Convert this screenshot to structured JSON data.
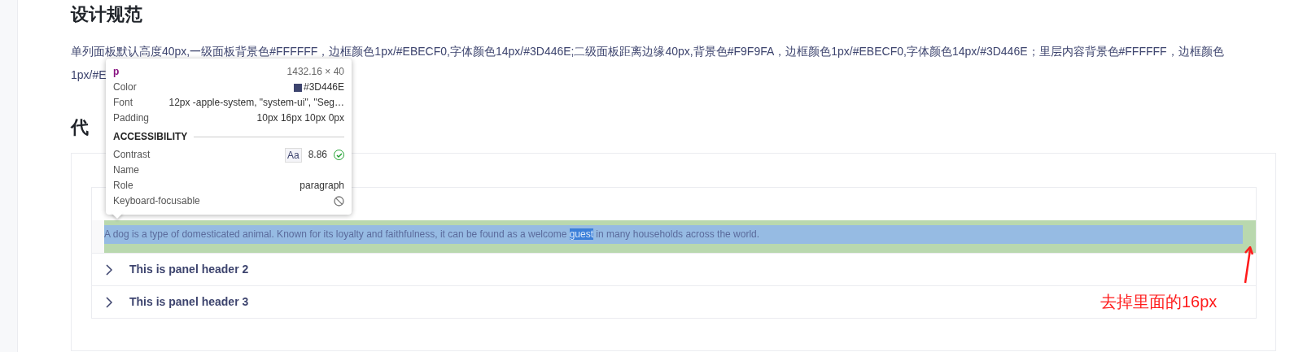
{
  "section_title": "设计规范",
  "description_lines": [
    "单列面板默认高度40px,一级面板背景色#FFFFFF，边框颜色1px/#EBECF0,字体颜色14px/#3D446E;二级面板距离边缘40px,背景色#F9F9FA，边框颜色1px/#EBECF0,字体颜色14px/#3D446E；里层内容背景色#FFFFFF，边框颜色",
    "1px/#E"
  ],
  "demo_title": "代",
  "panels": [
    {
      "expanded": true,
      "content": [
        {
          "text": "A dog is a type of domesticated animal. Known for its loyalty and faithfulness, it can be found as a welcome ",
          "highlighted": false
        },
        {
          "text": "guest",
          "highlighted": true
        },
        {
          "text": " in many households across the world.",
          "highlighted": false
        }
      ]
    },
    {
      "header": "This is panel header 2",
      "expanded": false
    },
    {
      "header": "This is panel header 3",
      "expanded": false
    }
  ],
  "inspector": {
    "tag": "p",
    "size": "1432.16 × 40",
    "rows": [
      {
        "kind": "color",
        "label": "Color",
        "value": "#3D446E"
      },
      {
        "kind": "text",
        "label": "Font",
        "value": "12px -apple-system, \"system-ui\", \"Seg…"
      },
      {
        "kind": "text",
        "label": "Padding",
        "value": "10px 16px 10px 0px"
      }
    ],
    "section": "ACCESSIBILITY",
    "contrast": {
      "label": "Contrast",
      "badge": "Aa",
      "value": "8.86",
      "passed": true
    },
    "name_label": "Name",
    "role": {
      "label": "Role",
      "value": "paragraph"
    },
    "focusable": {
      "label": "Keyboard-focusable",
      "focusable": false
    }
  },
  "annotation": "去掉里面的16px"
}
